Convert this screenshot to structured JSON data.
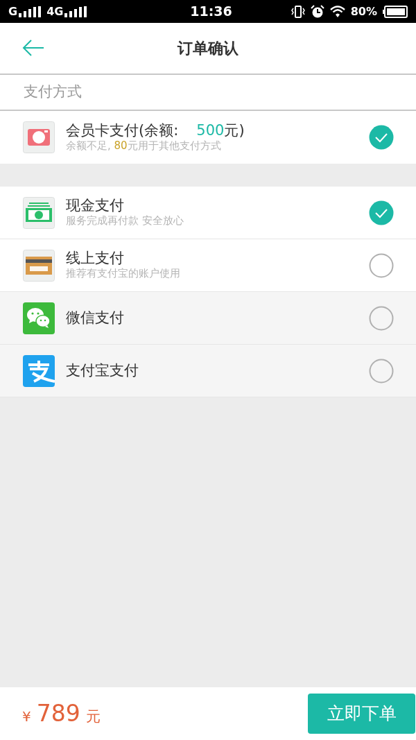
{
  "status_bar": {
    "carrier_1": "G",
    "carrier_2": "4G",
    "time": "11:36",
    "battery": "80%"
  },
  "header": {
    "title": "订单确认"
  },
  "section_label": "支付方式",
  "member_card": {
    "kind": "vip",
    "title_parts": [
      {
        "text": "会员卡支付(余额:"
      },
      {
        "text": "500",
        "color": "#1cb9a6"
      },
      {
        "text": "元)"
      }
    ],
    "subtitle_parts": [
      {
        "text": "余额不足, "
      },
      {
        "text": "80",
        "color": "#c9a227"
      },
      {
        "text": "元用于其他支付方式"
      }
    ],
    "selected": true
  },
  "methods": [
    {
      "kind": "cash",
      "title": "现金支付",
      "subtitle": "服务完成再付款 安全放心",
      "selected": true
    },
    {
      "kind": "visa",
      "title": "线上支付",
      "subtitle": "推荐有支付宝的账户使用",
      "selected": false
    }
  ],
  "app_methods": [
    {
      "kind": "wechat",
      "title": "微信支付",
      "selected": false
    },
    {
      "kind": "alipay",
      "title": "支付宝支付",
      "selected": false
    }
  ],
  "footer": {
    "currency": "¥",
    "amount": "789",
    "unit": "元",
    "submit_button": "立即下单"
  }
}
